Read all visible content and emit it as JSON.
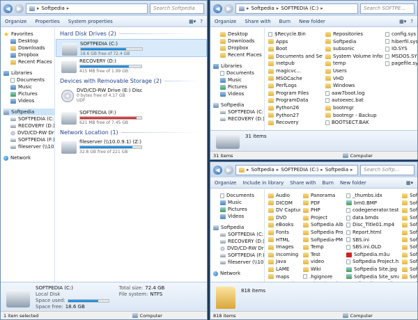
{
  "windows": {
    "left": {
      "address": [
        "Softpedia"
      ],
      "search_placeholder": "Search Softpedia",
      "toolbar": [
        "Organize",
        "Properties",
        "System properties"
      ],
      "nav": {
        "favorites": {
          "label": "Favorites",
          "items": [
            "Desktop",
            "Downloads",
            "Dropbox",
            "Recent Places"
          ]
        },
        "libraries": {
          "label": "Libraries",
          "items": [
            "Documents",
            "Music",
            "Pictures",
            "Videos"
          ]
        },
        "computer": {
          "label": "Softpedia",
          "items": [
            "SOFTPEDIA (C:)",
            "RECOVERY (D:)",
            "DVD/CD-RW Drive (E:)",
            "SOFTPEDIA (F:)",
            "fileserver (\\\\10.0.9.1) (Z:)"
          ]
        },
        "network": "Network"
      },
      "groups": {
        "hdd": "Hard Disk Drives (2)",
        "removable": "Devices with Removable Storage (2)",
        "network": "Network Location (1)"
      },
      "drives": {
        "c": {
          "name": "SOFTPEDIA (C:)",
          "free": "18.6 GB free of 72.4 GB",
          "used_fraction": 0.74
        },
        "d": {
          "name": "RECOVERY (D:)",
          "free": "415 MB free of 1.99 GB",
          "used_fraction": 0.8
        },
        "e": {
          "name": "DVD/CD-RW Drive (E:) Disc",
          "free": "0 bytes free of 4.17 GB",
          "fs": "UDF"
        },
        "f": {
          "name": "SOFTPEDIA (F:)",
          "free": "621 MB free of 7.45 GB",
          "used_fraction": 0.92
        },
        "z": {
          "name": "fileserver (\\\\10.0.9.1) (Z:)",
          "free": "32.8 GB free of 221 GB",
          "used_fraction": 0.85
        }
      },
      "details": {
        "name": "SOFTPEDIA (C:)",
        "type": "Local Disk",
        "space_used_label": "Space used:",
        "space_free_label": "Space free:",
        "space_free": "18.6 GB",
        "used_fraction": 0.74,
        "total_label": "Total size:",
        "total": "72.4 GB",
        "fs_label": "File system:",
        "fs": "NTFS"
      },
      "status": {
        "left": "1 item selected",
        "right": "Computer"
      }
    },
    "top_right": {
      "address": [
        "Softpedia",
        "SOFTPEDIA (C:)"
      ],
      "search_placeholder": "Search SOFTPE...",
      "toolbar": [
        "Organize",
        "Share with",
        "Burn",
        "New folder"
      ],
      "nav": [
        "Desktop",
        "Downloads",
        "Dropbox",
        "Recent Places",
        "",
        "Libraries",
        "Documents",
        "Music",
        "Pictures",
        "Videos",
        "",
        "Softpedia",
        "SOFTPEDIA (C:)",
        "RECOVERY (D:)"
      ],
      "files": {
        "col1": [
          "$Recycle.Bin",
          "Apps",
          "Boot",
          "Documents and Settings",
          "inetpub",
          "magicvc...",
          "MSOCache",
          "PerfLogs",
          "Program Files",
          "ProgramData",
          "Python26",
          "Python27",
          "Recovery"
        ],
        "col2": [
          "Repositories",
          "Softpedia",
          "subsonic",
          "System Volume Information",
          "temp",
          "Users",
          "VHD",
          "Windows",
          "aaw7boot.log",
          "autoexec.bat",
          "bootmgr",
          "bootmgr - Backup",
          "BOOTSECT.BAK"
        ],
        "col3": [
          "config.sys",
          "hiberfil.sys",
          "IO.SYS",
          "MSDOS.SYS",
          "pagefile.sys"
        ]
      },
      "count": "31 items",
      "status": {
        "left": "31 items",
        "right": "Computer"
      }
    },
    "bottom_right": {
      "address": [
        "Softpedia",
        "SOFTPEDIA (C:)",
        "Softpedia"
      ],
      "search_placeholder": "Search Softp...",
      "toolbar": [
        "Organize",
        "Include in library",
        "Share with",
        "Burn",
        "New folder"
      ],
      "nav": [
        "Documents",
        "Music",
        "Pictures",
        "Videos",
        "",
        "Softpedia",
        "SOFTPEDIA (C:)",
        "RECOVERY (D:)",
        "DVD/CD-RW Drive",
        "SOFTPEDIA (F:)",
        "fileserver (\\\\10.0.9.1)",
        "",
        "Network"
      ],
      "files": {
        "col1": [
          "Audio",
          "DICOM",
          "DV Capture",
          "DVD",
          "eBooks",
          "Fonts",
          "HTML",
          "Images",
          "incoming",
          "Java",
          "LAME",
          "maps",
          "My Web Sites"
        ],
        "col2": [
          "Panorama",
          "PDF",
          "PHP",
          "Project",
          "Softpedia Album",
          "Softpedia Project",
          "Softpedia-PM",
          "Temp",
          "Test",
          "video",
          "Wiki",
          ".hgignore",
          "_thumbs.ctl"
        ],
        "col3": [
          "_thumbs.idx",
          "bm0.BMP",
          "codegenerator.test",
          "data.bmds",
          "Disc_Title01.mp4",
          "Report.html",
          "SBS.ini",
          "SBS.ini.OLD",
          "Softpedia.m3u",
          "Softpedia Project.hxp",
          "Softpedia Site.jpg",
          "Softpedia Site_small.jpg",
          "Softpedia Test.djo"
        ],
        "col4": [
          "Softp",
          "Softp",
          "Softp",
          "Softp",
          "Softp",
          "Softp",
          "Softp",
          "Softp",
          "Softp",
          "Softp",
          "Softp",
          "Softp",
          "Softp"
        ]
      },
      "count": "818 items",
      "status": {
        "left": "818 items",
        "right": "Computer"
      }
    }
  }
}
